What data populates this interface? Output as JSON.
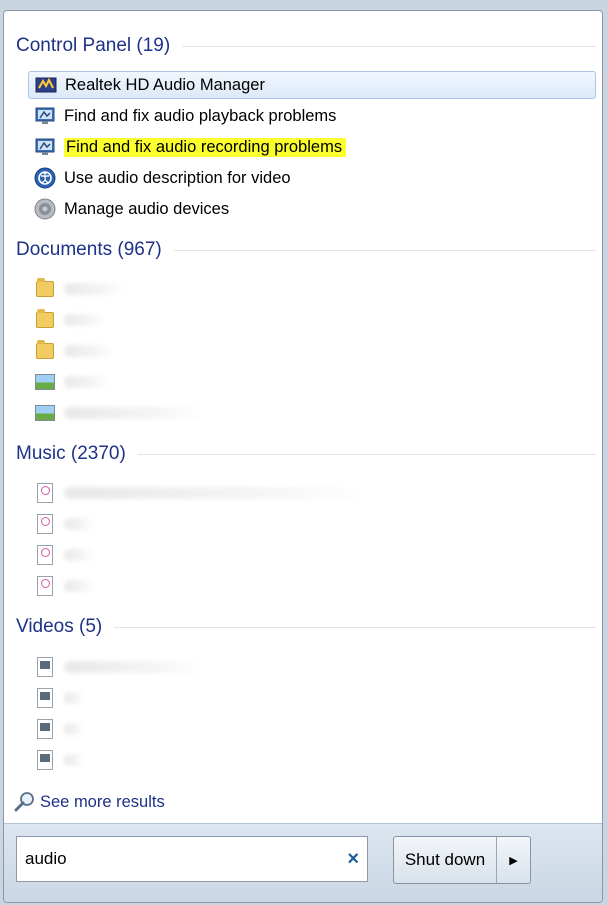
{
  "sections": {
    "control_panel": {
      "title": "Control Panel (19)",
      "items": [
        {
          "label": "Realtek HD Audio Manager",
          "icon": "realtek-audio-icon"
        },
        {
          "label": "Find and fix audio playback problems",
          "icon": "troubleshoot-icon"
        },
        {
          "label": "Find and fix audio recording problems",
          "icon": "troubleshoot-icon"
        },
        {
          "label": "Use audio description for video",
          "icon": "ease-of-access-icon"
        },
        {
          "label": "Manage audio devices",
          "icon": "speaker-icon"
        }
      ]
    },
    "documents": {
      "title": "Documents (967)"
    },
    "music": {
      "title": "Music (2370)"
    },
    "videos": {
      "title": "Videos (5)"
    }
  },
  "see_more": "See more results",
  "search": {
    "value": "audio",
    "clear": "×"
  },
  "shutdown": {
    "label": "Shut down",
    "arrow": "▶"
  },
  "colors": {
    "highlight": "#fcff2e",
    "heading": "#1e3287",
    "selected_border": "#a9c4e4"
  }
}
